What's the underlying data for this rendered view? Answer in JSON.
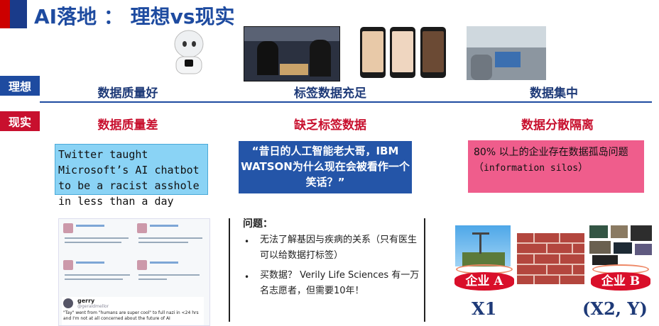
{
  "title": "AI落地 ： 理想vs现实",
  "rows": {
    "ideal": "理想",
    "real": "现实"
  },
  "ideal_heads": [
    "数据质量好",
    "标签数据充足",
    "数据集中"
  ],
  "real_heads": [
    "数据质量差",
    "缺乏标签数据",
    "数据分散隔离"
  ],
  "twitter_text": "Twitter taught Microsoft’s AI chatbot to be a racist asshole in less than a day",
  "ibm_text": "“昔日的人工智能老大哥，IBM WATSON为什么现在会被看作一个笑话？”",
  "silo": {
    "prefix": "80% 以上的企业存在数据孤岛问题（",
    "mono": "information silos",
    "suffix": "）"
  },
  "problem": {
    "head": "问题：",
    "bullets": [
      "无法了解基因与疾病的关系（只有医生可以给数据打标签）",
      "买数据？ Verily Life Sciences 有一万名志愿者，但需要10年！"
    ]
  },
  "tweets": {
    "user": "gerry",
    "handle": "@geraldmellor",
    "quote": "\"Tay\" went from \"humans are super cool\" to full nazi in <24 hrs and I'm not at all concerned about the future of AI"
  },
  "enterprise": {
    "a": "企业 A",
    "b": "企业 B",
    "x1": "X1",
    "x2y": "(X2, Y)"
  },
  "colors": {
    "blue": "#1e4ba0",
    "red": "#c8102e",
    "pink": "#ef5d8c",
    "cyan": "#8ad3f5"
  }
}
